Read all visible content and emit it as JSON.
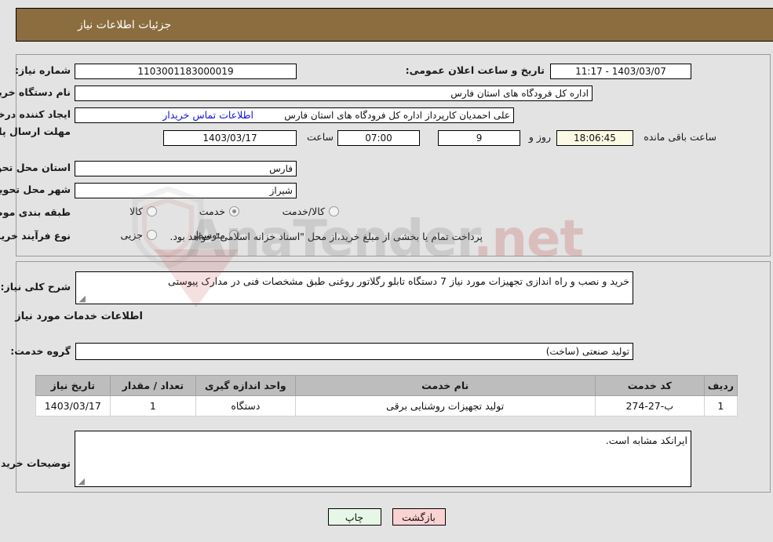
{
  "header": {
    "title": "جزئیات اطلاعات نیاز"
  },
  "form": {
    "need_number_label": "شماره نیاز:",
    "need_number_value": "1103001183000019",
    "announce_label": "تاریخ و ساعت اعلان عمومی:",
    "announce_value": "1403/03/07 - 11:17",
    "buyer_org_label": "نام دستگاه خریدار:",
    "buyer_org_value": "اداره کل فرودگاه های استان فارس",
    "creator_label": "ایجاد کننده درخواست:",
    "creator_value": "علی  احمدیان کارپرداز اداره کل فرودگاه های استان فارس",
    "contact_link": "اطلاعات تماس خریدار",
    "deadline_label": "مهلت ارسال پاسخ: تا تاریخ:",
    "deadline_date": "1403/03/17",
    "hour_label": "ساعت",
    "deadline_time": "07:00",
    "days_value": "9",
    "days_label": "روز و",
    "countdown_value": "18:06:45",
    "countdown_label": "ساعت باقی مانده",
    "province_label": "استان محل تحویل:",
    "province_value": "فارس",
    "city_label": "شهر محل تحویل:",
    "city_value": "شیراز",
    "category_label": "طبقه بندی موضوعی:",
    "category_options": [
      {
        "label": "کالا",
        "selected": false
      },
      {
        "label": "خدمت",
        "selected": true
      },
      {
        "label": "کالا/خدمت",
        "selected": false
      }
    ],
    "process_label": "نوع فرآیند خرید :",
    "process_options": [
      {
        "label": "جزیی",
        "selected": false
      },
      {
        "label": "متوسط",
        "selected": false
      }
    ],
    "process_note": "پرداخت تمام یا بخشی از مبلغ خرید،از محل \"اسناد خزانه اسلامی\" خواهد بود."
  },
  "description": {
    "summary_label": "شرح کلی نیاز:",
    "summary_value": "خرید و نصب و راه اندازی تجهیزات مورد نیاز 7 دستگاه تابلو رگلاتور روغنی طبق مشخصات فنی در مدارک پیوستی",
    "section_heading": "اطلاعات خدمات مورد نیاز",
    "service_group_label": "گروه خدمت:",
    "service_group_value": "تولید صنعتی (ساخت)"
  },
  "table": {
    "columns": [
      "ردیف",
      "کد خدمت",
      "نام خدمت",
      "واحد اندازه گیری",
      "تعداد / مقدار",
      "تاریخ نیاز"
    ],
    "rows": [
      {
        "index": "1",
        "code": "ب-27-274",
        "name": "تولید تجهیزات روشنایی برقی",
        "unit": "دستگاه",
        "qty": "1",
        "date": "1403/03/17"
      }
    ]
  },
  "notes": {
    "label": "توضیحات خریدار:",
    "value": "ایرانکد مشابه است."
  },
  "buttons": {
    "print": "چاپ",
    "back": "بازگشت"
  },
  "watermark": {
    "text_a": "Ana",
    "text_b": "Tender",
    "text_c": ".net"
  },
  "colors": {
    "titlebar": "#8c6d3f",
    "background": "#e3e3e3",
    "link": "#1313e0",
    "table_header": "#bdbdbd",
    "btn_print": "#e7f7e7",
    "btn_back": "#fbd2d2",
    "countdown_bg": "#fbfbe4"
  }
}
